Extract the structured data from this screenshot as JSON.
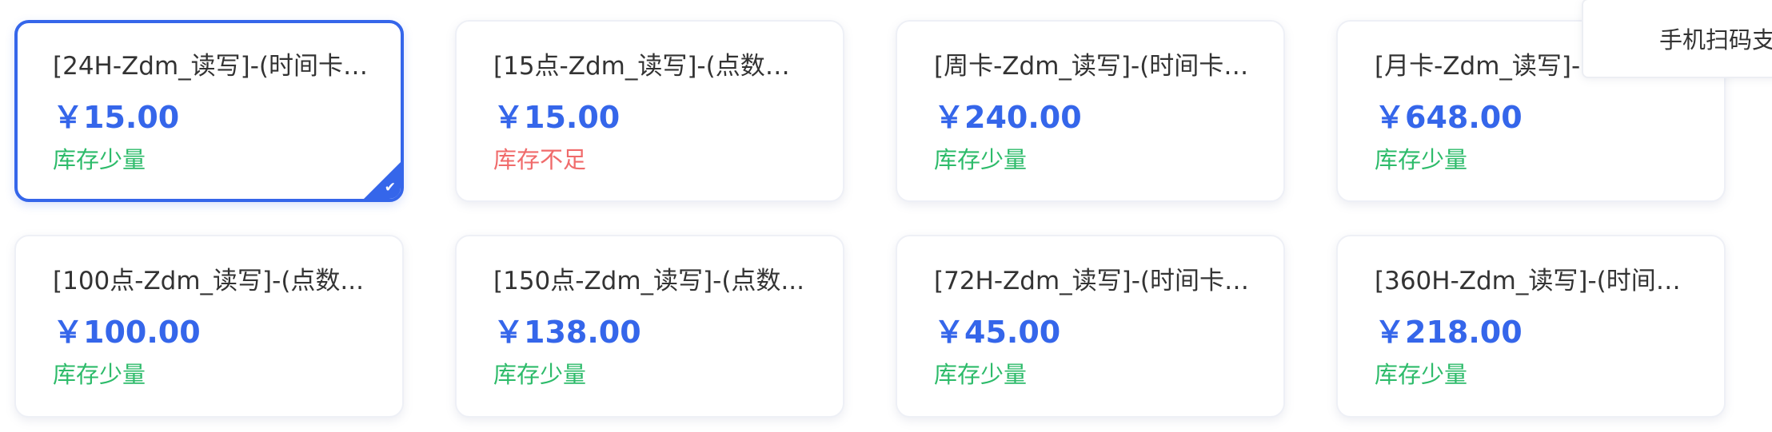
{
  "products": [
    {
      "name": "[24H-Zdm_读写]-(时间卡_...",
      "price": "￥15.00",
      "stock": "库存少量",
      "stock_color": "#2dbb6a",
      "selected": true
    },
    {
      "name": "[15点-Zdm_读写]-(点数卡_...",
      "price": "￥15.00",
      "stock": "库存不足",
      "stock_color": "#f06b6b",
      "selected": false
    },
    {
      "name": "[周卡-Zdm_读写]-(时间卡_...",
      "price": "￥240.00",
      "stock": "库存少量",
      "stock_color": "#2dbb6a",
      "selected": false
    },
    {
      "name": "[月卡-Zdm_读写]-(时间卡_...",
      "price": "￥648.00",
      "stock": "库存少量",
      "stock_color": "#2dbb6a",
      "selected": false
    },
    {
      "name": "[100点-Zdm_读写]-(点数...",
      "price": "￥100.00",
      "stock": "库存少量",
      "stock_color": "#2dbb6a",
      "selected": false
    },
    {
      "name": "[150点-Zdm_读写]-(点数...",
      "price": "￥138.00",
      "stock": "库存少量",
      "stock_color": "#2dbb6a",
      "selected": false
    },
    {
      "name": "[72H-Zdm_读写]-(时间卡-...",
      "price": "￥45.00",
      "stock": "库存少量",
      "stock_color": "#2dbb6a",
      "selected": false
    },
    {
      "name": "[360H-Zdm_读写]-(时间卡...",
      "price": "￥218.00",
      "stock": "库存少量",
      "stock_color": "#2dbb6a",
      "selected": false
    }
  ],
  "selected_check": "✔",
  "side_panel": {
    "label": "手机扫码支付"
  },
  "colors": {
    "accent": "#3566ea",
    "in_stock": "#2dbb6a",
    "low_stock": "#f06b6b"
  }
}
